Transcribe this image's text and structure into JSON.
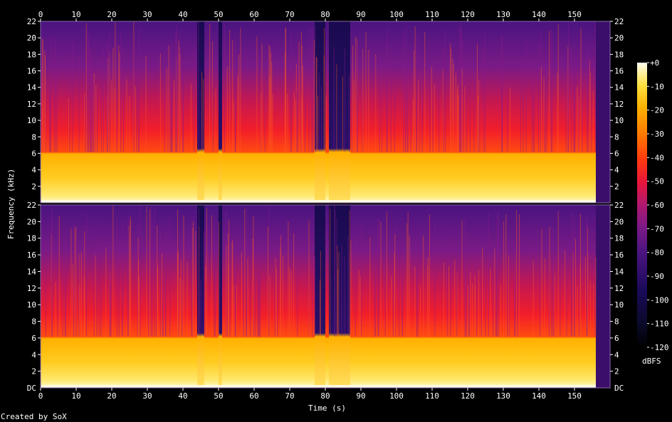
{
  "chart_data": {
    "type": "heatmap",
    "xlabel": "Time (s)",
    "ylabel": "Frequency (kHz)",
    "x_ticks": [
      "0",
      "10",
      "20",
      "30",
      "40",
      "50",
      "60",
      "70",
      "80",
      "90",
      "100",
      "110",
      "120",
      "130",
      "140",
      "150"
    ],
    "y_ticks": [
      "2",
      "4",
      "6",
      "8",
      "10",
      "12",
      "14",
      "16",
      "18",
      "20",
      "22"
    ],
    "y_bottom_label": "DC",
    "channels": 2,
    "xlim": [
      0,
      156
    ],
    "ylim_khz": [
      0,
      22
    ],
    "colorbar": {
      "label": "dBFS",
      "ticks": [
        "+0",
        "-10",
        "-20",
        "-30",
        "-40",
        "-50",
        "-60",
        "-70",
        "-80",
        "-90",
        "-100",
        "-110",
        "-120"
      ],
      "range": [
        -120,
        0
      ]
    },
    "quiet_gaps_s": [
      [
        44,
        46
      ],
      [
        50,
        51
      ],
      [
        77,
        80
      ],
      [
        81,
        87
      ]
    ],
    "audio_end_s": 156
  },
  "footer": {
    "credit": "Created by SoX"
  }
}
